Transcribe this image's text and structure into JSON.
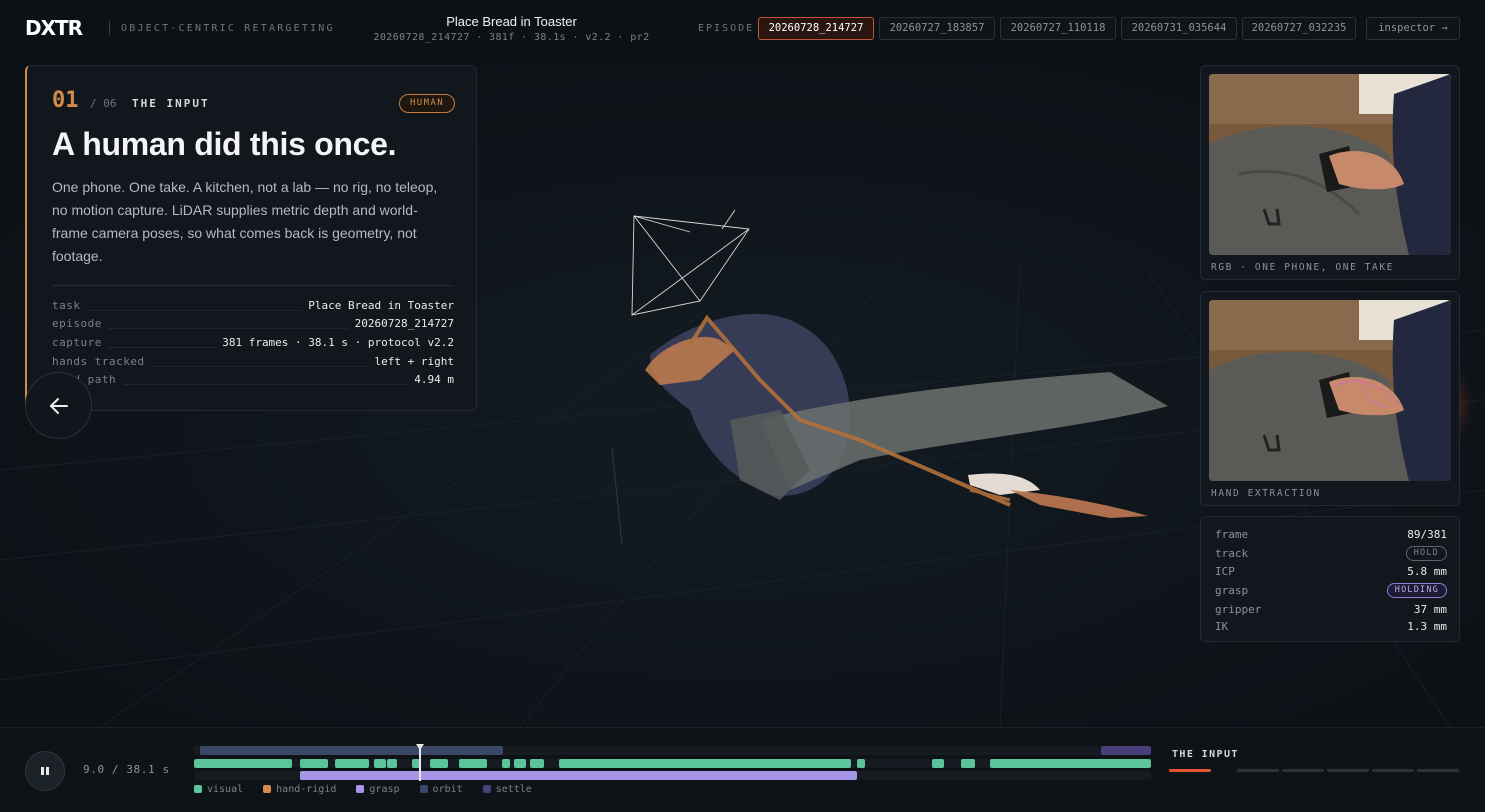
{
  "header": {
    "logo_text": "DXTR",
    "tagline": "OBJECT-CENTRIC RETARGETING",
    "episode_title": "Place Bread in Toaster",
    "episode_subtitle": "20260728_214727 · 381f · 38.1s · v2.2 · pr2",
    "episode_label": "EPISODE",
    "episodes": [
      {
        "label": "20260728_214727",
        "active": true
      },
      {
        "label": "20260727_183857",
        "active": false
      },
      {
        "label": "20260727_110118",
        "active": false
      },
      {
        "label": "20260731_035644",
        "active": false
      },
      {
        "label": "20260727_032235",
        "active": false
      }
    ],
    "inspector_label": "inspector →"
  },
  "card": {
    "step_number": "01",
    "step_total": "/ 06",
    "step_name": "THE INPUT",
    "badge": "HUMAN",
    "heading": "A human did this once.",
    "body": "One phone. One take. A kitchen, not a lab — no rig, no teleop, no motion capture. LiDAR supplies metric depth and world-frame camera poses, so what comes back is geometry, not footage.",
    "facts": [
      {
        "key": "task",
        "value": "Place Bread in Toaster"
      },
      {
        "key": "episode",
        "value": "20260728_214727"
      },
      {
        "key": "capture",
        "value": "381 frames · 38.1 s · protocol v2.2"
      },
      {
        "key": "hands tracked",
        "value": "left + right"
      },
      {
        "key": "hand path",
        "value": "4.94 m"
      }
    ]
  },
  "nav": {
    "prev_icon": "arrow-left-icon",
    "next_icon": "arrow-right-icon"
  },
  "panels": {
    "rgb_caption": "RGB · ONE PHONE, ONE TAKE",
    "hand_caption": "HAND EXTRACTION"
  },
  "stats": {
    "frame": {
      "key": "frame",
      "value": "89/381"
    },
    "track": {
      "key": "track",
      "value": "HOLD"
    },
    "icp": {
      "key": "ICP",
      "value": "5.8 mm"
    },
    "grasp": {
      "key": "grasp",
      "value": "HOLDING"
    },
    "gripper": {
      "key": "gripper",
      "value": "37 mm"
    },
    "ik": {
      "key": "IK",
      "value": "1.3 mm"
    }
  },
  "playback": {
    "time": "9.0 / 38.1 s",
    "duration_s": 38.1,
    "current_s": 9.0,
    "legend": [
      "visual",
      "hand-rigid",
      "grasp",
      "orbit",
      "settle"
    ],
    "colors": {
      "visual": "#5cc49a",
      "hand-rigid": "#d48a4a",
      "grasp": "#a796e8",
      "orbit": "#3b4766",
      "settle": "#4a3f7a",
      "accent": "#e3542e"
    },
    "step_label": "THE INPUT",
    "steps_total": 6,
    "step_current": 1
  }
}
